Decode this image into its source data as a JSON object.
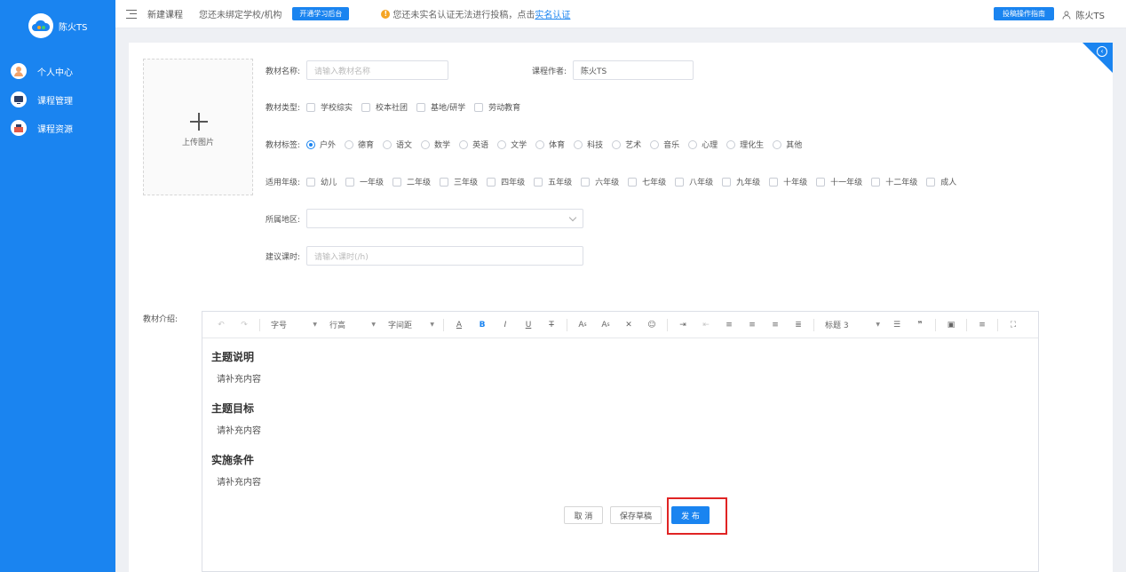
{
  "brand": {
    "name": "陈火TS"
  },
  "sidebar": {
    "items": [
      {
        "label": "个人中心",
        "icon": "avatar-icon"
      },
      {
        "label": "课程管理",
        "icon": "monitor-icon"
      },
      {
        "label": "课程资源",
        "icon": "resource-icon"
      }
    ]
  },
  "header": {
    "crumb": "新建课程",
    "bind_tip": "您还未绑定学校/机构",
    "open_button": "开通学习后台",
    "warning_prefix": "您还未实名认证无法进行投稿，点击",
    "warning_link": "实名认证",
    "guide_button": "投稿操作指南",
    "username": "陈火TS"
  },
  "form": {
    "upload_label": "上传图片",
    "name_label": "教材名称:",
    "name_placeholder": "请输入教材名称",
    "author_label": "课程作者:",
    "author_value": "陈火TS",
    "type_label": "教材类型:",
    "types": [
      "学校综实",
      "校本社团",
      "基地/研学",
      "劳动教育"
    ],
    "tag_label": "教材标签:",
    "tags": [
      "户外",
      "德育",
      "语文",
      "数学",
      "英语",
      "文学",
      "体育",
      "科技",
      "艺术",
      "音乐",
      "心理",
      "理化生",
      "其他"
    ],
    "tag_selected": "户外",
    "grade_label": "适用年级:",
    "grades": [
      "幼儿",
      "一年级",
      "二年级",
      "三年级",
      "四年级",
      "五年级",
      "六年级",
      "七年级",
      "八年级",
      "九年级",
      "十年级",
      "十一年级",
      "十二年级",
      "成人"
    ],
    "region_label": "所属地区:",
    "hours_label": "建议课时:",
    "hours_placeholder": "请输入课时(/h)",
    "intro_label": "教材介绍:"
  },
  "editor": {
    "font_size": "字号",
    "line_height": "行高",
    "letter_spacing": "字间距",
    "heading": "标题 3",
    "sections": [
      {
        "title": "主题说明",
        "body": "请补充内容"
      },
      {
        "title": "主题目标",
        "body": "请补充内容"
      },
      {
        "title": "实施条件",
        "body": "请补充内容"
      }
    ]
  },
  "actions": {
    "cancel": "取 消",
    "draft": "保存草稿",
    "publish": "发 布"
  },
  "colors": {
    "primary": "#1a84f0",
    "highlight": "#e02424",
    "warning": "#f5a524"
  }
}
